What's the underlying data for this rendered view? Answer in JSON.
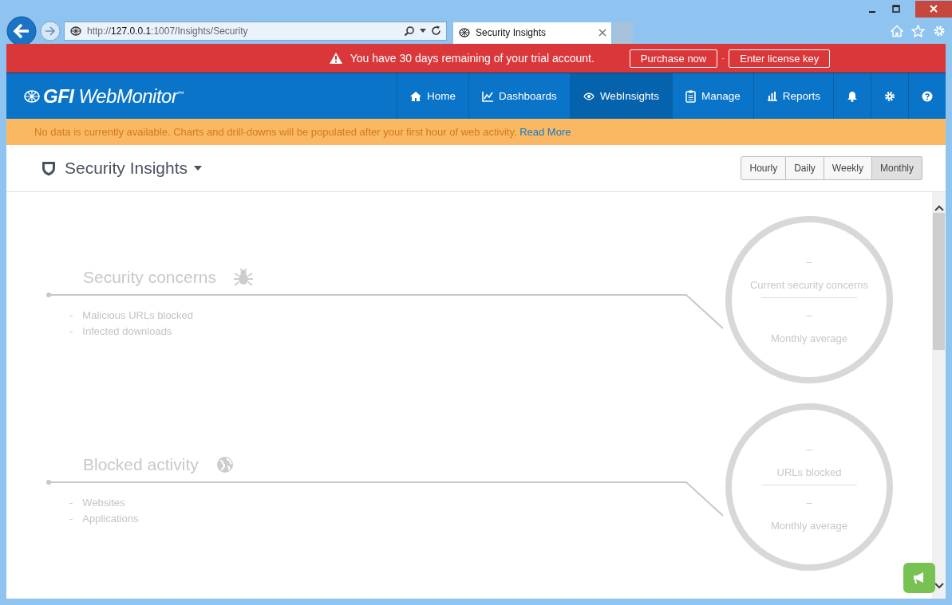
{
  "browser": {
    "url": {
      "prefix": "http://",
      "host": "127.0.0.1",
      "path": ":1007/Insights/Security"
    },
    "tab": {
      "title": "Security Insights"
    }
  },
  "trial_banner": {
    "message": "You have 30 days remaining of your trial account.",
    "separator": "-",
    "buttons": [
      "Purchase now",
      "Enter license key"
    ]
  },
  "nav": {
    "logo": {
      "brand": "GFI",
      "product": "WebMonitor",
      "mark": "™"
    },
    "items": [
      {
        "label": "Home",
        "selected": false
      },
      {
        "label": "Dashboards",
        "selected": false
      },
      {
        "label": "WebInsights",
        "selected": true
      },
      {
        "label": "Manage",
        "selected": false
      },
      {
        "label": "Reports",
        "selected": false
      },
      {
        "selected": false
      },
      {
        "selected": false
      },
      {
        "selected": false
      }
    ]
  },
  "notice": {
    "text": "No data is currently available. Charts and drill-downs will be populated after your first hour of web activity.",
    "link": "Read More"
  },
  "header": {
    "title": "Security Insights",
    "periods": [
      {
        "label": "Hourly",
        "selected": false
      },
      {
        "label": "Daily",
        "selected": false
      },
      {
        "label": "Weekly",
        "selected": false
      },
      {
        "label": "Monthly",
        "selected": true
      }
    ]
  },
  "sections": [
    {
      "title": "Security concerns",
      "items": [
        {
          "bullet": "-",
          "text": "Malicious URLs blocked"
        },
        {
          "bullet": "-",
          "text": "Infected downloads"
        }
      ],
      "circle": {
        "value": "–",
        "label": "Current security concerns",
        "avg_value": "–",
        "avg_label": "Monthly average"
      }
    },
    {
      "title": "Blocked activity",
      "items": [
        {
          "bullet": "-",
          "text": "Websites"
        },
        {
          "bullet": "-",
          "text": "Applications"
        }
      ],
      "circle": {
        "value": "–",
        "label": "URLs blocked",
        "avg_value": "–",
        "avg_label": "Monthly average"
      }
    }
  ]
}
